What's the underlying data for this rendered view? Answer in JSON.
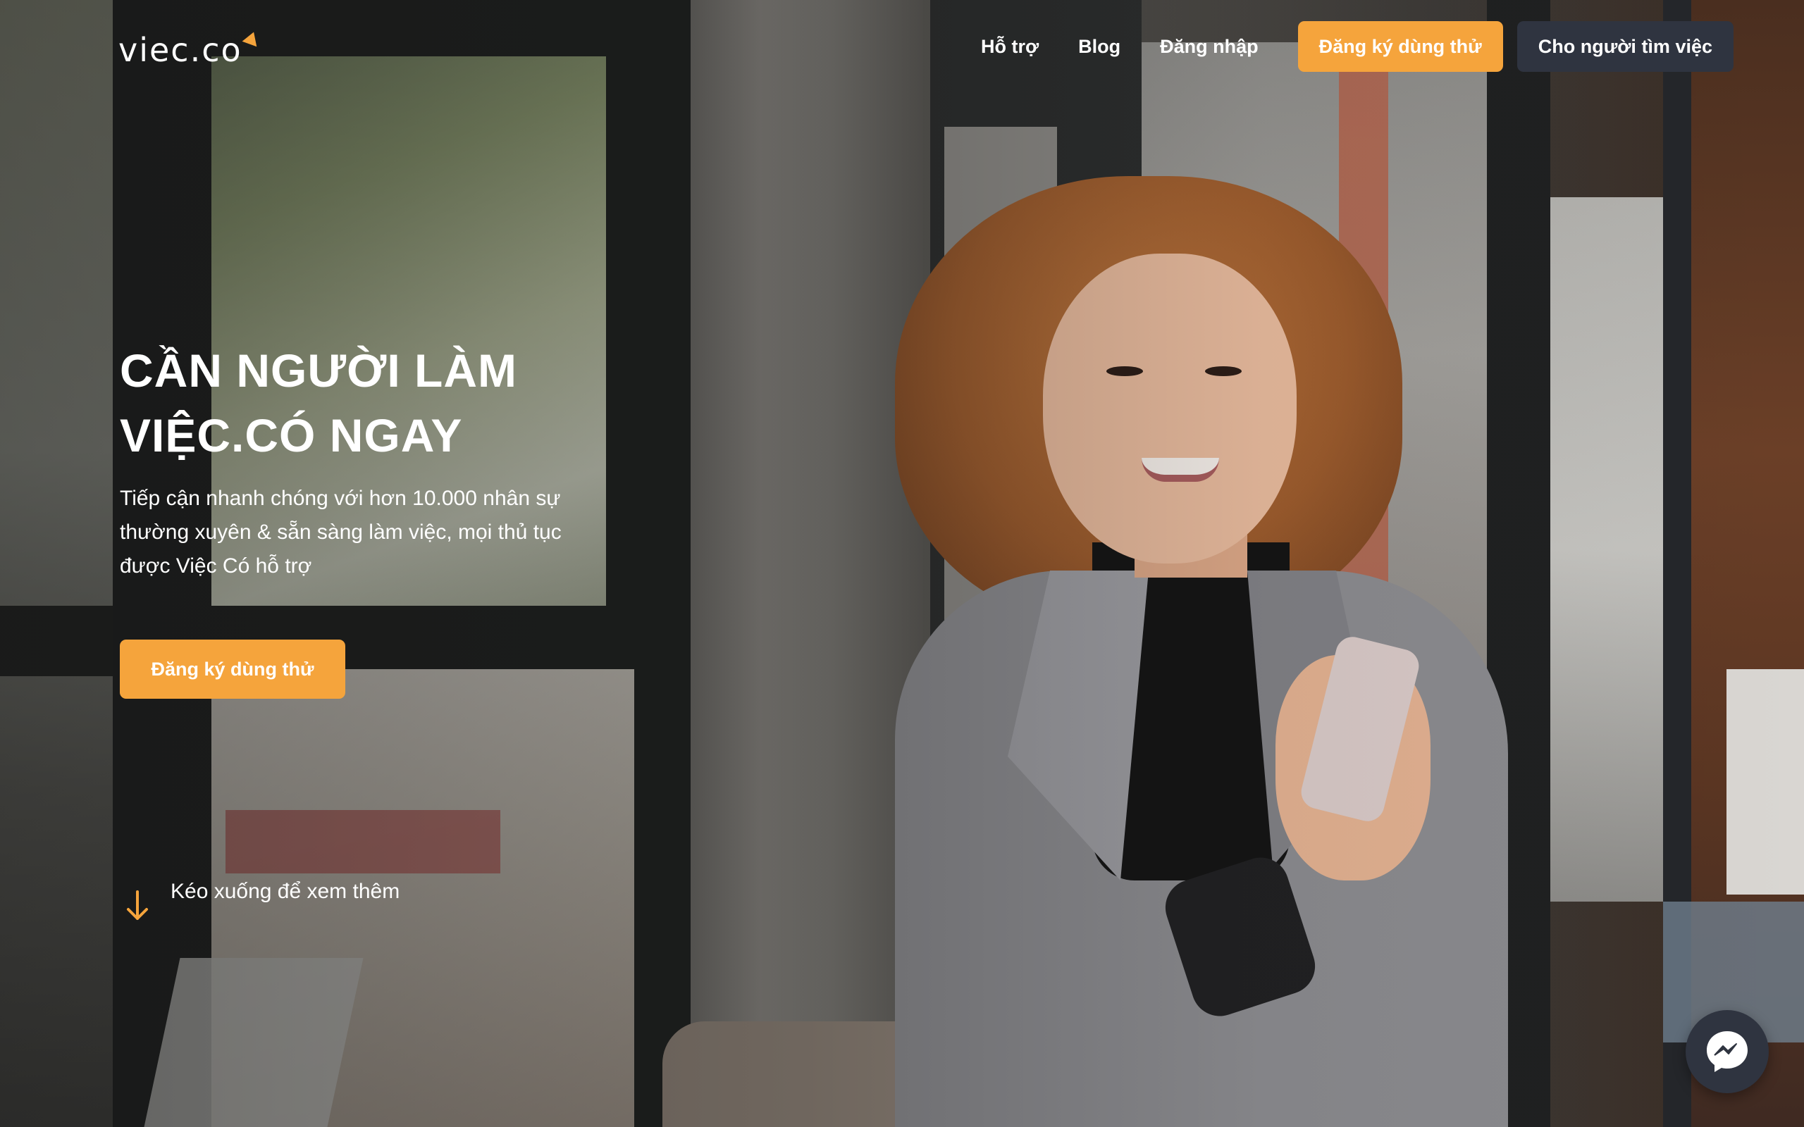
{
  "brand": {
    "logo_text": "viec.co",
    "accent_color": "#f5a43c",
    "dark_button_color": "#2f3440"
  },
  "nav": {
    "links": [
      "Hỗ trợ",
      "Blog",
      "Đăng nhập"
    ],
    "trial_button": "Đăng ký dùng thử",
    "jobseeker_button": "Cho người tìm việc"
  },
  "hero": {
    "title_line1": "CẦN NGƯỜI LÀM",
    "title_line2": "VIỆC.CÓ NGAY",
    "subtitle_line1": "Tiếp cận nhanh chóng với hơn 10.000 nhân sự",
    "subtitle_line2": "thường xuyên & sẵn sàng làm việc, mọi thủ tục",
    "subtitle_line3": "được Việc Có hỗ trợ",
    "cta": "Đăng ký dùng thử",
    "scroll_hint": "Kéo xuống để xem thêm"
  },
  "icons": {
    "scroll": "arrow-down-icon",
    "chat": "messenger-icon"
  }
}
